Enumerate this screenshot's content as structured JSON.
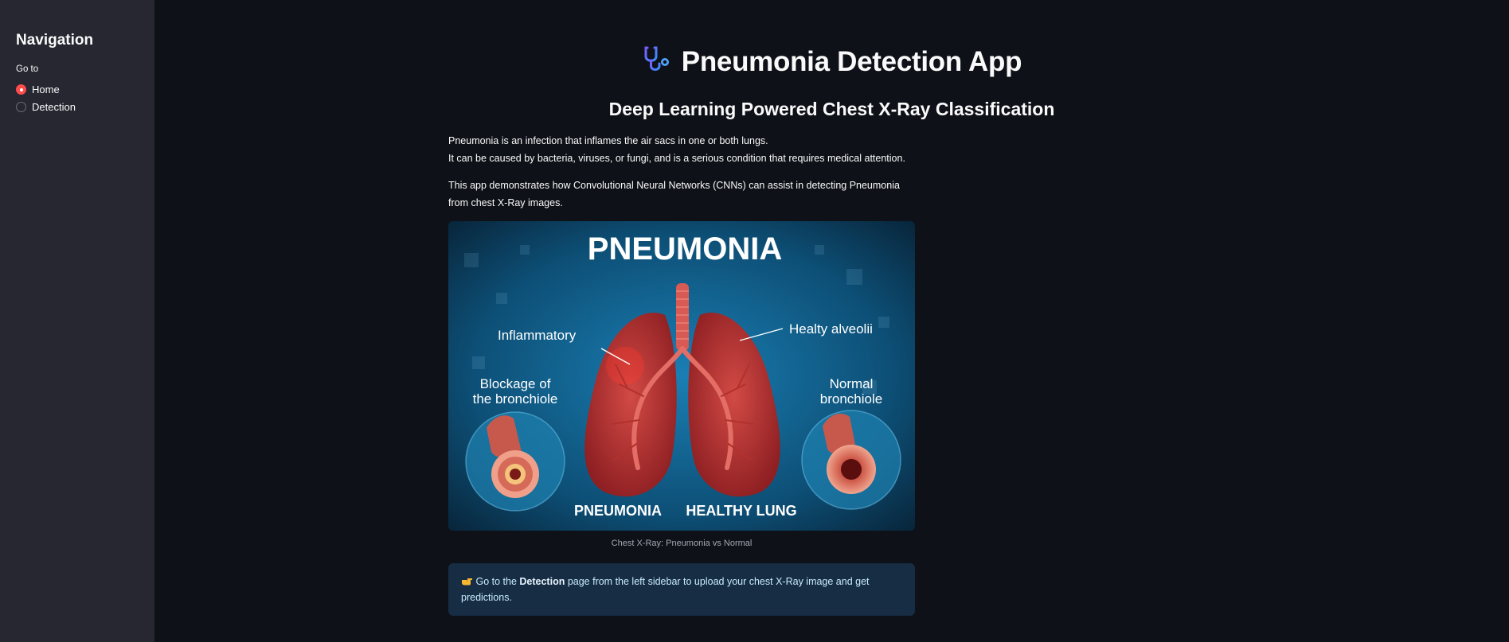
{
  "sidebar": {
    "title": "Navigation",
    "radio_label": "Go to",
    "options": [
      {
        "label": "Home",
        "selected": true
      },
      {
        "label": "Detection",
        "selected": false
      }
    ]
  },
  "header": {
    "icon": "stethoscope-icon",
    "title": "Pneumonia Detection App",
    "subtitle": "Deep Learning Powered Chest X-Ray Classification"
  },
  "intro": {
    "line1": "Pneumonia is an infection that inflames the air sacs in one or both lungs.",
    "line2": "It can be caused by bacteria, viruses, or fungi, and is a serious condition that requires medical attention.",
    "para2": "This app demonstrates how Convolutional Neural Networks (CNNs) can assist in detecting Pneumonia from chest X-Ray images."
  },
  "hero_image": {
    "heading": "PNEUMONIA",
    "label_inflammatory": "Inflammatory",
    "label_healthy": "Healty alveolii",
    "label_blockage_1": "Blockage of",
    "label_blockage_2": "the bronchiole",
    "label_normal_1": "Normal",
    "label_normal_2": "bronchiole",
    "bottom_left": "PNEUMONIA",
    "bottom_right": "HEALTHY LUNG",
    "caption": "Chest X-Ray: Pneumonia vs Normal"
  },
  "info": {
    "icon": "pointing-hand-icon",
    "prefix": "Go to the ",
    "bold": "Detection",
    "suffix": " page from the left sidebar to upload your chest X-Ray image and get predictions."
  },
  "colors": {
    "background": "#0e1117",
    "sidebar": "#262730",
    "accent": "#ff4b4b",
    "info_bg": "#172d43",
    "info_text": "#c7ebff"
  }
}
